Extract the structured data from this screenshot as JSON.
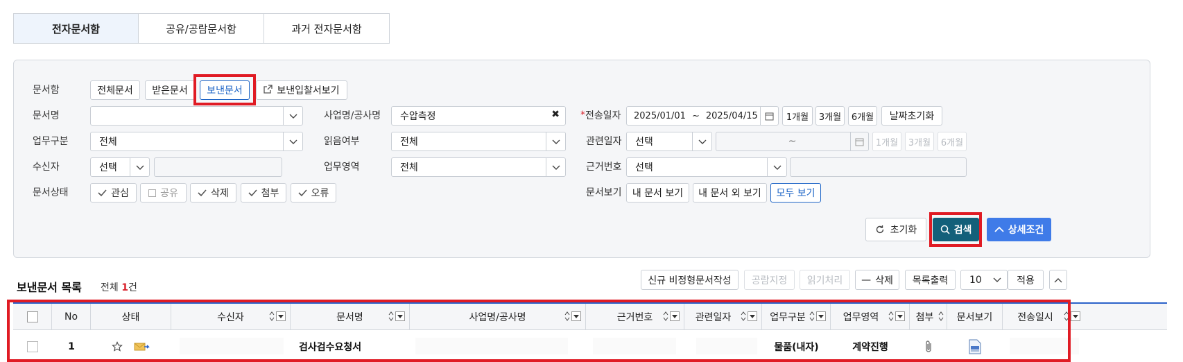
{
  "tabs": [
    "전자문서함",
    "공유/공람문서함",
    "과거 전자문서함"
  ],
  "filters": {
    "box_label": "문서함",
    "box_buttons": [
      "전체문서",
      "받은문서",
      "보낸문서"
    ],
    "bid_view": "보낸입찰서보기",
    "doc_name_label": "문서명",
    "doc_name_value": "",
    "business_label": "사업명/공사명",
    "business_value": "수압측정",
    "send_date_label": "전송일자",
    "date_from": "2025/01/01",
    "date_to": "2025/04/15",
    "date_sep": "~",
    "period_buttons": [
      "1개월",
      "3개월",
      "6개월"
    ],
    "reset_date": "날짜초기화",
    "work_type_label": "업무구분",
    "work_type_value": "전체",
    "read_label": "읽음여부",
    "read_value": "전체",
    "related_date_label": "관련일자",
    "related_date_value": "선택",
    "related_date_sep": "~",
    "receiver_label": "수신자",
    "receiver_value": "선택",
    "work_area_label": "업무영역",
    "work_area_value": "전체",
    "basis_label": "근거번호",
    "basis_value": "선택",
    "status_label": "문서상태",
    "status_checks": [
      {
        "label": "관심",
        "checked": true
      },
      {
        "label": "공유",
        "checked": false
      },
      {
        "label": "삭제",
        "checked": true
      },
      {
        "label": "첨부",
        "checked": true
      },
      {
        "label": "오류",
        "checked": true
      }
    ],
    "view_label": "문서보기",
    "view_buttons": [
      "내 문서 보기",
      "내 문서 외 보기",
      "모두 보기"
    ],
    "reset": "초기화",
    "search": "검색",
    "detail": "상세조건"
  },
  "list": {
    "title": "보낸문서 목록",
    "count_prefix": "전체 ",
    "count": "1",
    "count_suffix": "건",
    "actions": [
      "신규 비정형문서작성",
      "공람지정",
      "읽기처리",
      "삭제",
      "목록출력"
    ],
    "page_size": "10",
    "apply": "적용",
    "columns": [
      "No",
      "상태",
      "수신자",
      "문서명",
      "사업명/공사명",
      "근거번호",
      "관련일자",
      "업무구분",
      "업무영역",
      "첨부",
      "문서보기",
      "전송일시"
    ],
    "rows": [
      {
        "no": "1",
        "doc_name": "검사검수요청서",
        "work_type": "물품(내자)",
        "work_area": "계약진행"
      }
    ]
  },
  "colors": {
    "accent": "#2b62c9",
    "search_btn": "#13607a",
    "detail_btn": "#3f7be8",
    "highlight": "#e01b24"
  }
}
